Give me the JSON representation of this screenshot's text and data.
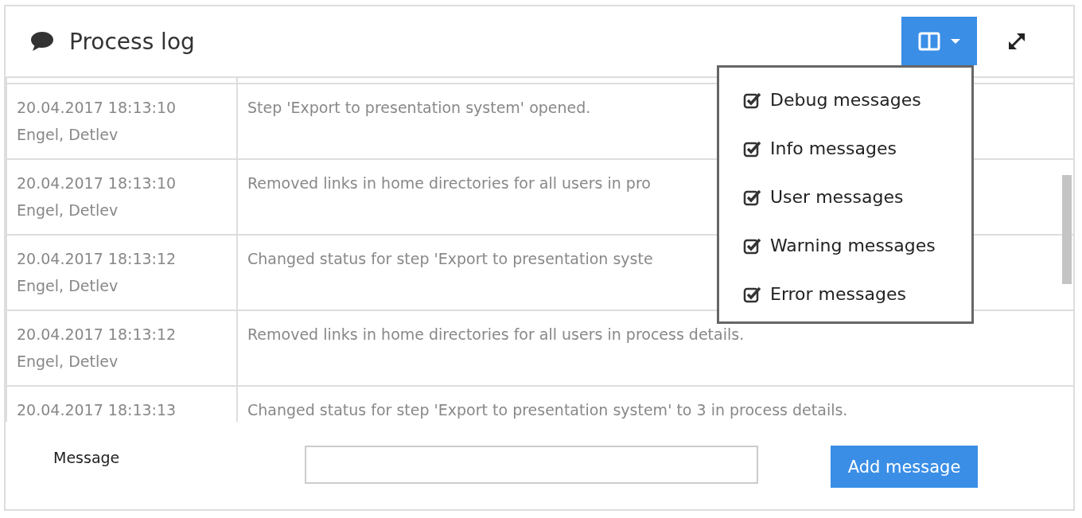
{
  "panel": {
    "title": "Process log"
  },
  "filter_menu": {
    "expanded": true,
    "items": [
      {
        "label": "Debug messages",
        "checked": true
      },
      {
        "label": "Info messages",
        "checked": true
      },
      {
        "label": "User messages",
        "checked": true
      },
      {
        "label": "Warning messages",
        "checked": true
      },
      {
        "label": "Error messages",
        "checked": true
      }
    ]
  },
  "log": {
    "rows": [
      {
        "timestamp": "20.04.2017 18:13:10",
        "user": "Engel, Detlev",
        "message": "Step 'Export to presentation system' opened."
      },
      {
        "timestamp": "20.04.2017 18:13:10",
        "user": "Engel, Detlev",
        "message": "Removed links in home directories for all users in pro"
      },
      {
        "timestamp": "20.04.2017 18:13:12",
        "user": "Engel, Detlev",
        "message": "Changed status for step 'Export to presentation syste"
      },
      {
        "timestamp": "20.04.2017 18:13:12",
        "user": "Engel, Detlev",
        "message": "Removed links in home directories for all users in process details."
      },
      {
        "timestamp": "20.04.2017 18:13:13",
        "message": "Changed status for step 'Export to presentation system' to 3 in process details."
      }
    ]
  },
  "form": {
    "label": "Message",
    "button": "Add message"
  }
}
